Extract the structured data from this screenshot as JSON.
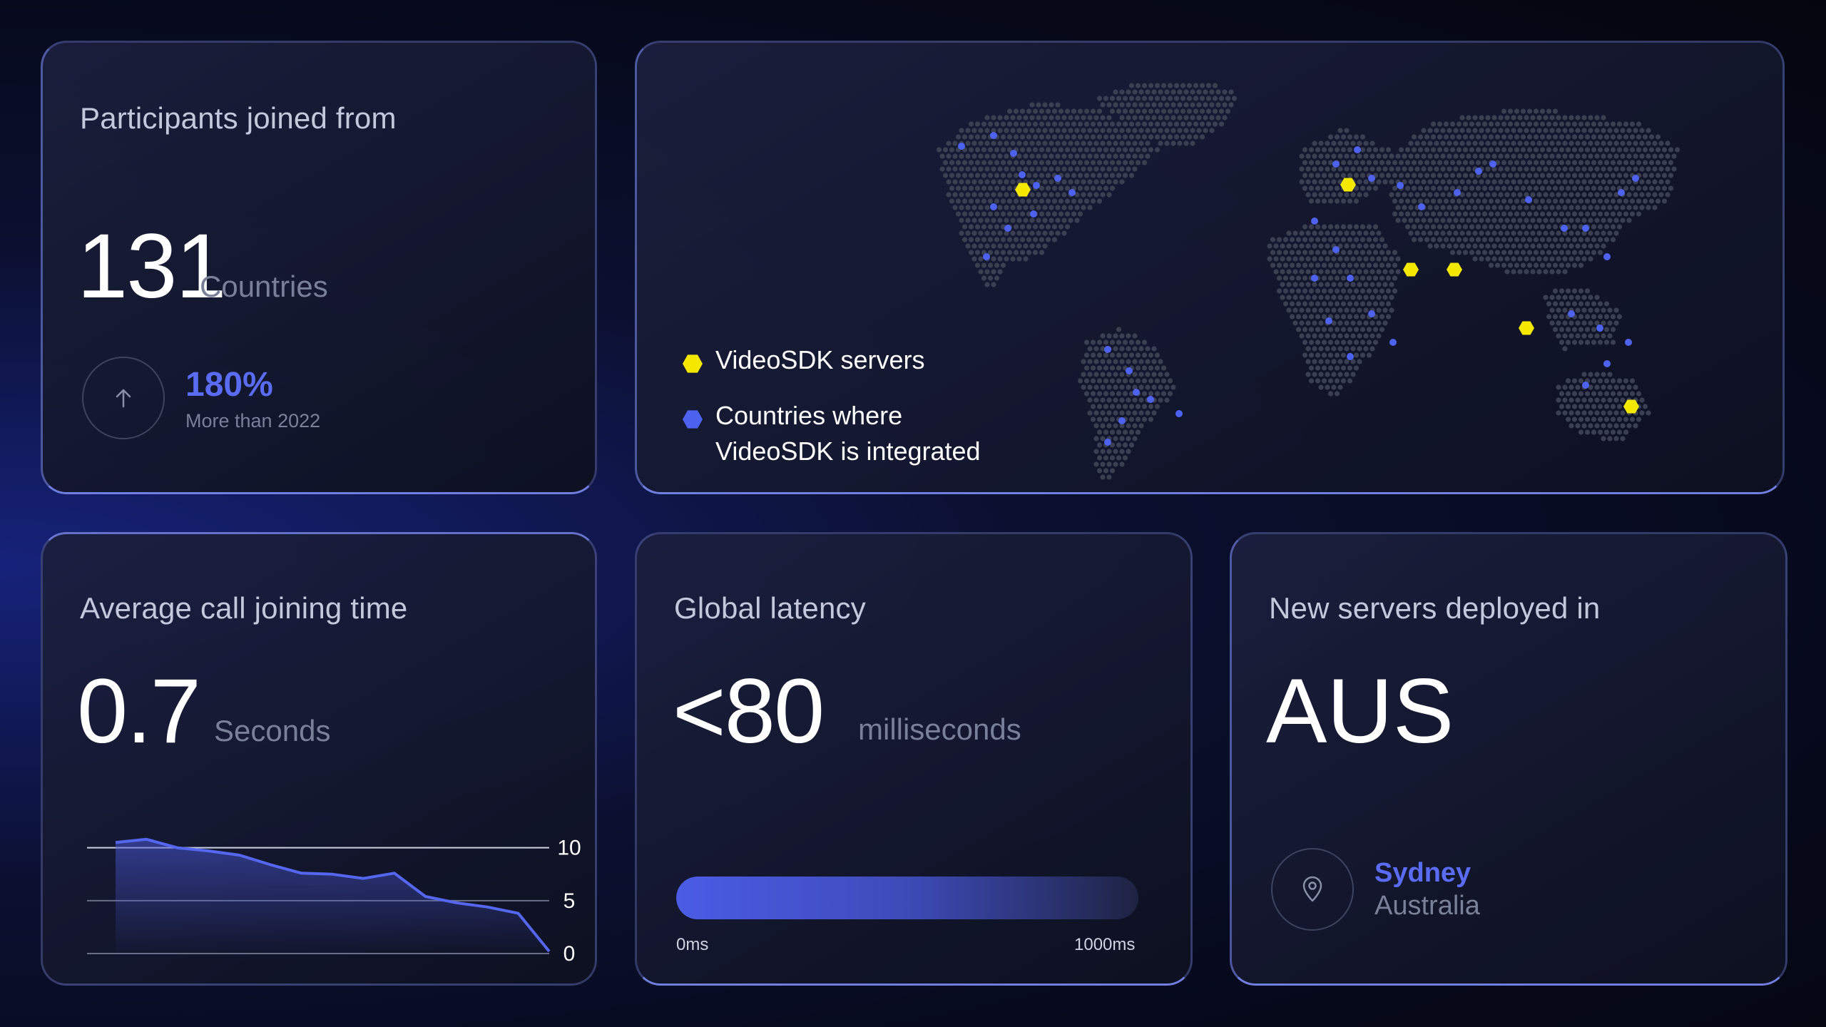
{
  "participants": {
    "title": "Participants joined from",
    "value": "131",
    "unit": "Countries",
    "growth": "180%",
    "growth_note": "More than 2022",
    "icon": "arrow-up-icon"
  },
  "map": {
    "legend_servers": "VideoSDK servers",
    "legend_countries_line1": "Countries where",
    "legend_countries_line2": "VideoSDK is integrated",
    "server_color": "#f5e800",
    "country_color": "#4e62f0"
  },
  "joining_time": {
    "title": "Average call joining time",
    "value": "0.7",
    "unit": "Seconds",
    "chart_data": {
      "type": "area",
      "values": [
        10.5,
        10.8,
        10.0,
        9.7,
        9.3,
        8.4,
        7.6,
        7.5,
        7.1,
        7.6,
        5.4,
        4.8,
        4.4,
        3.8,
        0.2
      ],
      "y_ticks": [
        "10",
        "5",
        "0"
      ],
      "ylim": [
        0,
        12
      ],
      "grid": true,
      "line_color": "#5566f0"
    }
  },
  "latency": {
    "title": "Global latency",
    "value": "<80",
    "unit": "milliseconds",
    "bar_min": "0ms",
    "bar_max": "1000ms",
    "fill_fraction": 1.0
  },
  "new_servers": {
    "title": "New servers deployed in",
    "value": "AUS",
    "city": "Sydney",
    "country": "Australia",
    "icon": "map-pin-icon"
  }
}
